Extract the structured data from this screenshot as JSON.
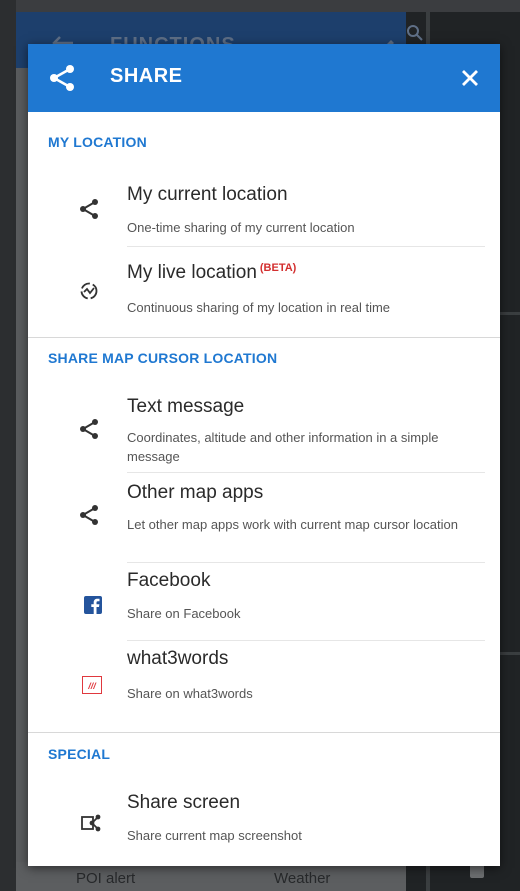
{
  "background": {
    "header_title": "FUNCTIONS",
    "bottom_labels": [
      "POI alert",
      "Weather"
    ]
  },
  "dialog": {
    "title": "SHARE",
    "sections": [
      {
        "header": "MY LOCATION",
        "items": [
          {
            "title": "My current location",
            "subtitle": "One-time sharing of my current location",
            "icon": "share-icon"
          },
          {
            "title": "My live location",
            "badge": "(BETA)",
            "subtitle": "Continuous sharing of my location in real time",
            "icon": "live-location-icon"
          }
        ]
      },
      {
        "header": "SHARE MAP CURSOR LOCATION",
        "items": [
          {
            "title": "Text message",
            "subtitle": "Coordinates, altitude and other information in a simple message",
            "icon": "share-icon"
          },
          {
            "title": "Other map apps",
            "subtitle": "Let other map apps work with current map cursor location",
            "icon": "share-icon"
          },
          {
            "title": "Facebook",
            "subtitle": "Share on Facebook",
            "icon": "facebook-icon"
          },
          {
            "title": "what3words",
            "subtitle": "Share on what3words",
            "icon": "what3words-icon",
            "icon_text": "///"
          }
        ]
      },
      {
        "header": "SPECIAL",
        "items": [
          {
            "title": "Share screen",
            "subtitle": "Share current map screenshot",
            "icon": "share-screen-icon"
          }
        ]
      }
    ]
  },
  "colors": {
    "accent": "#1f78d1",
    "beta": "#d32f2f",
    "facebook": "#24549c",
    "what3words": "#e0383e"
  }
}
